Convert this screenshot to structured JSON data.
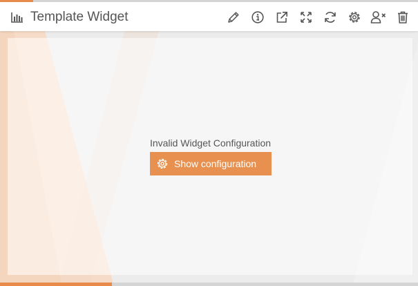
{
  "header": {
    "title": "Template Widget",
    "title_icon": "bar-chart-icon",
    "accent_color": "#e88a4a"
  },
  "toolbar": {
    "items": [
      {
        "name": "edit",
        "icon": "pencil-icon"
      },
      {
        "name": "info",
        "icon": "info-circle-icon"
      },
      {
        "name": "open-external",
        "icon": "external-link-icon"
      },
      {
        "name": "expand",
        "icon": "expand-icon"
      },
      {
        "name": "refresh",
        "icon": "refresh-icon"
      },
      {
        "name": "settings",
        "icon": "gear-icon"
      },
      {
        "name": "remove-user",
        "icon": "user-remove-icon"
      },
      {
        "name": "delete",
        "icon": "trash-icon"
      }
    ]
  },
  "main": {
    "message": "Invalid Widget Configuration",
    "config_button_label": "Show configuration",
    "config_button_icon": "gear-icon",
    "config_button_color": "#e8904f"
  }
}
